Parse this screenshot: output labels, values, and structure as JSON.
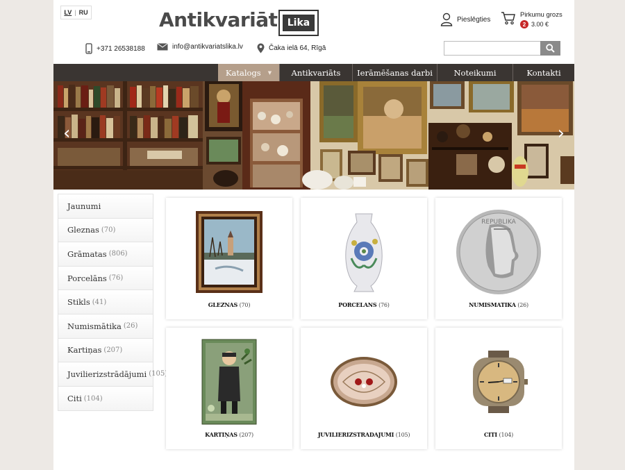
{
  "lang": {
    "lv": "LV",
    "ru": "RU"
  },
  "logo": {
    "text": "Antikvariāts",
    "badge": "Lika"
  },
  "header": {
    "login": "Pieslēgties",
    "cart_label": "Pirkumu grozs",
    "cart_count": "2",
    "cart_total": "3.00 €",
    "phone": "+371 26538188",
    "email": "info@antikvariatslika.lv",
    "address": "Čaka ielā 64, Rīgā",
    "search_placeholder": ""
  },
  "nav": [
    {
      "label": "Katalogs",
      "active": true
    },
    {
      "label": "Antikvariāts"
    },
    {
      "label": "Ierāmēšanas darbi"
    },
    {
      "label": "Noteikumi"
    },
    {
      "label": "Kontakti"
    }
  ],
  "sidebar": [
    {
      "label": "Jaunumi",
      "count": ""
    },
    {
      "label": "Gleznas",
      "count": "(70)"
    },
    {
      "label": "Grāmatas",
      "count": "(806)"
    },
    {
      "label": "Porcelāns",
      "count": "(76)"
    },
    {
      "label": "Stikls",
      "count": "(41)"
    },
    {
      "label": "Numismātika",
      "count": "(26)"
    },
    {
      "label": "Kartiņas",
      "count": "(207)"
    },
    {
      "label": "Juvilierizstrādājumi",
      "count": "(105)"
    },
    {
      "label": "Citi",
      "count": "(104)"
    }
  ],
  "categories": [
    {
      "label": "GLEZNAS",
      "count": "(70)",
      "icon": "painting-image"
    },
    {
      "label": "PORCELANS",
      "count": "(76)",
      "icon": "vase-image"
    },
    {
      "label": "NUMISMATIKA",
      "count": "(26)",
      "icon": "coin-image"
    },
    {
      "label": "KARTIŅAS",
      "count": "(207)",
      "icon": "postcard-image"
    },
    {
      "label": "JUVILIERIZSTRADAJUMI",
      "count": "(105)",
      "icon": "brooch-image"
    },
    {
      "label": "CITI",
      "count": "(104)",
      "icon": "watch-image"
    }
  ],
  "colors": {
    "nav_bg": "#3a3532",
    "nav_active": "#b59f8b",
    "badge": "#c62828"
  }
}
